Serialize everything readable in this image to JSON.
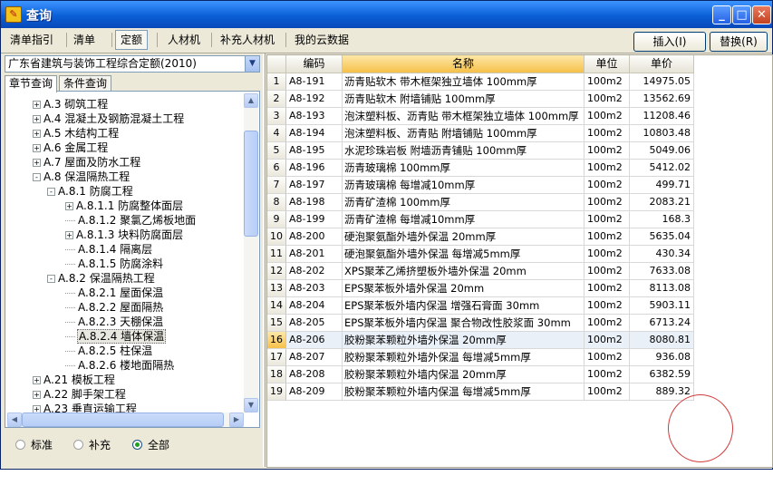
{
  "window": {
    "title": "查询",
    "icon": "app-icon",
    "controls": {
      "minimize": "_",
      "maximize": "□",
      "close": "✕"
    }
  },
  "tabs": [
    {
      "label": "清单指引",
      "active": false
    },
    {
      "label": "清单",
      "active": false
    },
    {
      "label": "定额",
      "active": true
    },
    {
      "label": "人材机",
      "active": false
    },
    {
      "label": "补充人材机",
      "active": false
    },
    {
      "label": "我的云数据",
      "active": false
    }
  ],
  "buttons": {
    "insert": "插入(I)",
    "replace": "替换(R)"
  },
  "left": {
    "quota_library": "广东省建筑与装饰工程综合定额(2010)",
    "subtabs": [
      {
        "label": "章节查询",
        "active": true
      },
      {
        "label": "条件查询",
        "active": false
      }
    ],
    "tree": [
      {
        "label": "A.3 砌筑工程",
        "level": 0,
        "toggle": "+"
      },
      {
        "label": "A.4 混凝土及钢筋混凝土工程",
        "level": 0,
        "toggle": "+"
      },
      {
        "label": "A.5 木结构工程",
        "level": 0,
        "toggle": "+"
      },
      {
        "label": "A.6 金属工程",
        "level": 0,
        "toggle": "+"
      },
      {
        "label": "A.7 屋面及防水工程",
        "level": 0,
        "toggle": "+"
      },
      {
        "label": "A.8 保温隔热工程",
        "level": 0,
        "toggle": "-"
      },
      {
        "label": "A.8.1 防腐工程",
        "level": 1,
        "toggle": "-"
      },
      {
        "label": "A.8.1.1 防腐整体面层",
        "level": 2,
        "toggle": "+"
      },
      {
        "label": "A.8.1.2 聚氯乙烯板地面",
        "level": 2,
        "toggle": ""
      },
      {
        "label": "A.8.1.3 块料防腐面层",
        "level": 2,
        "toggle": "+"
      },
      {
        "label": "A.8.1.4 隔离层",
        "level": 2,
        "toggle": ""
      },
      {
        "label": "A.8.1.5 防腐涂料",
        "level": 2,
        "toggle": ""
      },
      {
        "label": "A.8.2 保温隔热工程",
        "level": 1,
        "toggle": "-"
      },
      {
        "label": "A.8.2.1 屋面保温",
        "level": 2,
        "toggle": ""
      },
      {
        "label": "A.8.2.2 屋面隔热",
        "level": 2,
        "toggle": ""
      },
      {
        "label": "A.8.2.3 天棚保温",
        "level": 2,
        "toggle": ""
      },
      {
        "label": "A.8.2.4 墙体保温",
        "level": 2,
        "toggle": "",
        "selected": true
      },
      {
        "label": "A.8.2.5 柱保温",
        "level": 2,
        "toggle": ""
      },
      {
        "label": "A.8.2.6 楼地面隔热",
        "level": 2,
        "toggle": ""
      },
      {
        "label": "A.21 模板工程",
        "level": 0,
        "toggle": "+"
      },
      {
        "label": "A.22 脚手架工程",
        "level": 0,
        "toggle": "+"
      },
      {
        "label": "A.23 垂直运输工程",
        "level": 0,
        "toggle": "+"
      }
    ],
    "filters": [
      {
        "label": "标准",
        "checked": false
      },
      {
        "label": "补充",
        "checked": false
      },
      {
        "label": "全部",
        "checked": true
      }
    ]
  },
  "grid": {
    "columns": [
      "编码",
      "名称",
      "单位",
      "单价"
    ],
    "rows": [
      {
        "no": "1",
        "code": "A8-191",
        "name": "沥青贴软木 带木框架独立墙体 100mm厚",
        "unit": "100m2",
        "price": "14975.05"
      },
      {
        "no": "2",
        "code": "A8-192",
        "name": "沥青贴软木 附墙铺贴 100mm厚",
        "unit": "100m2",
        "price": "13562.69"
      },
      {
        "no": "3",
        "code": "A8-193",
        "name": "泡沫塑料板、沥青贴 带木框架独立墙体 100mm厚",
        "unit": "100m2",
        "price": "11208.46"
      },
      {
        "no": "4",
        "code": "A8-194",
        "name": "泡沫塑料板、沥青贴 附墙铺贴 100mm厚",
        "unit": "100m2",
        "price": "10803.48"
      },
      {
        "no": "5",
        "code": "A8-195",
        "name": "水泥珍珠岩板 附墙沥青铺贴 100mm厚",
        "unit": "100m2",
        "price": "5049.06"
      },
      {
        "no": "6",
        "code": "A8-196",
        "name": "沥青玻璃棉 100mm厚",
        "unit": "100m2",
        "price": "5412.02"
      },
      {
        "no": "7",
        "code": "A8-197",
        "name": "沥青玻璃棉 每增减10mm厚",
        "unit": "100m2",
        "price": "499.71"
      },
      {
        "no": "8",
        "code": "A8-198",
        "name": "沥青矿渣棉 100mm厚",
        "unit": "100m2",
        "price": "2083.21"
      },
      {
        "no": "9",
        "code": "A8-199",
        "name": "沥青矿渣棉 每增减10mm厚",
        "unit": "100m2",
        "price": "168.3"
      },
      {
        "no": "10",
        "code": "A8-200",
        "name": "硬泡聚氨酯外墙外保温 20mm厚",
        "unit": "100m2",
        "price": "5635.04"
      },
      {
        "no": "11",
        "code": "A8-201",
        "name": "硬泡聚氨酯外墙外保温 每增减5mm厚",
        "unit": "100m2",
        "price": "430.34"
      },
      {
        "no": "12",
        "code": "A8-202",
        "name": "XPS聚苯乙烯挤塑板外墙外保温 20mm",
        "unit": "100m2",
        "price": "7633.08"
      },
      {
        "no": "13",
        "code": "A8-203",
        "name": "EPS聚苯板外墙外保温 20mm",
        "unit": "100m2",
        "price": "8113.08"
      },
      {
        "no": "14",
        "code": "A8-204",
        "name": "EPS聚苯板外墙内保温 增强石膏面 30mm",
        "unit": "100m2",
        "price": "5903.11"
      },
      {
        "no": "15",
        "code": "A8-205",
        "name": "EPS聚苯板外墙内保温 聚合物改性胶浆面 30mm",
        "unit": "100m2",
        "price": "6713.24"
      },
      {
        "no": "16",
        "code": "A8-206",
        "name": "胶粉聚苯颗粒外墙外保温 20mm厚",
        "unit": "100m2",
        "price": "8080.81",
        "selected": true
      },
      {
        "no": "17",
        "code": "A8-207",
        "name": "胶粉聚苯颗粒外墙外保温 每增减5mm厚",
        "unit": "100m2",
        "price": "936.08"
      },
      {
        "no": "18",
        "code": "A8-208",
        "name": "胶粉聚苯颗粒外墙内保温 20mm厚",
        "unit": "100m2",
        "price": "6382.59"
      },
      {
        "no": "19",
        "code": "A8-209",
        "name": "胶粉聚苯颗粒外墙内保温 每增减5mm厚",
        "unit": "100m2",
        "price": "889.32"
      }
    ]
  },
  "colors": {
    "titlebar": "#0a5fd6",
    "highlight": "#f6c04a",
    "annotation": "#d23b3b"
  }
}
